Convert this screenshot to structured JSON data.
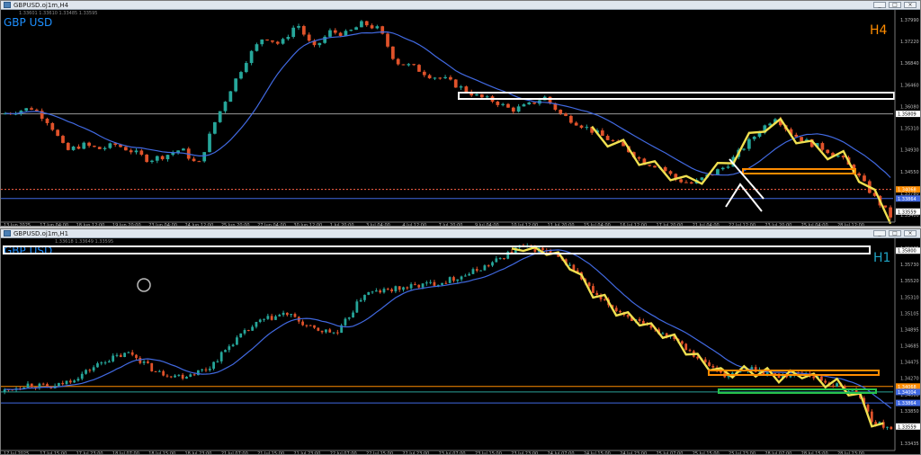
{
  "windows": [
    {
      "window_title": "GBPUSD.oj1m,H4",
      "symbol": "GBP USD",
      "timeframe": "H4",
      "ohlc_info": "1.33601 1.33610 1.33485 1.33595",
      "buttons": [
        "_",
        "□",
        "×"
      ]
    },
    {
      "window_title": "GBPUSD.oj1m,H1",
      "symbol": "GBP USD",
      "timeframe": "H1",
      "ohlc_info": "1.33618 1.33649 1.33595",
      "buttons": [
        "_",
        "□",
        "×"
      ]
    }
  ],
  "colors": {
    "background": "#000000",
    "bull": "#26a69a",
    "bear": "#e0522a",
    "ma": "#4169e1",
    "zigzag": "#f0e050",
    "white_marker": "#ffffff",
    "orange_zone": "#ff8c00",
    "green_zone": "#27c24c",
    "symbol_text": "#1e90ff",
    "tf_h4": "#ff8c00",
    "tf_h1": "#1fa3c4"
  },
  "chart_data": [
    {
      "type": "candlestick",
      "title": "GBPUSD H4",
      "ylim": [
        1.334,
        1.381
      ],
      "y_ticks": [
        "1.37990",
        "1.37220",
        "1.36840",
        "1.36460",
        "1.36080",
        "1.35310",
        "1.34930",
        "1.34550",
        "1.33780",
        "1.33400"
      ],
      "x_ticks": [
        "13 Jun 2025",
        "17 Jun 04:00",
        "18 Jun 12:00",
        "19 Jun 20:00",
        "23 Jun 04:00",
        "24 Jun 12:00",
        "25 Jun 20:00",
        "27 Jun 04:00",
        "30 Jun 12:00",
        "1 Jul 20:00",
        "3 Jul 04:00",
        "4 Jul 12:00",
        "7 Jul 20:00",
        "9 Jul 04:00",
        "10 Jul 12:00",
        "11 Jul 20:00",
        "15 Jul 04:00",
        "16 Jul 12:00",
        "17 Jul 20:00",
        "21 Jul 04:00",
        "22 Jul 12:00",
        "23 Jul 20:00",
        "25 Jul 04:00",
        "28 Jul 12:00"
      ],
      "close_path": [
        [
          0,
          1.358
        ],
        [
          2,
          1.3595
        ],
        [
          3,
          1.356
        ],
        [
          4,
          1.3495
        ],
        [
          5,
          1.351
        ],
        [
          6,
          1.35
        ],
        [
          7,
          1.351
        ],
        [
          8,
          1.3495
        ],
        [
          9,
          1.3475
        ],
        [
          10,
          1.3485
        ],
        [
          11,
          1.35
        ],
        [
          12,
          1.346
        ],
        [
          13,
          1.356
        ],
        [
          14,
          1.364
        ],
        [
          15,
          1.371
        ],
        [
          16,
          1.376
        ],
        [
          17,
          1.374
        ],
        [
          18,
          1.379
        ],
        [
          19,
          1.373
        ],
        [
          20,
          1.377
        ],
        [
          21,
          1.3765
        ],
        [
          22,
          1.379
        ],
        [
          23,
          1.3775
        ],
        [
          24,
          1.37
        ],
        [
          25,
          1.369
        ],
        [
          26,
          1.367
        ],
        [
          27,
          1.366
        ],
        [
          28,
          1.364
        ],
        [
          29,
          1.362
        ],
        [
          30,
          1.361
        ],
        [
          31,
          1.359
        ],
        [
          32,
          1.36
        ],
        [
          33,
          1.362
        ],
        [
          34,
          1.358
        ],
        [
          35,
          1.356
        ],
        [
          36,
          1.354
        ],
        [
          37,
          1.352
        ],
        [
          38,
          1.35
        ],
        [
          39,
          1.347
        ],
        [
          40,
          1.346
        ],
        [
          41,
          1.343
        ],
        [
          42,
          1.342
        ],
        [
          43,
          1.344
        ],
        [
          44,
          1.346
        ],
        [
          45,
          1.35
        ],
        [
          46,
          1.354
        ],
        [
          47,
          1.3575
        ],
        [
          48,
          1.3535
        ],
        [
          49,
          1.3515
        ],
        [
          50,
          1.35
        ],
        [
          51,
          1.348
        ],
        [
          52,
          1.344
        ],
        [
          53,
          1.339
        ],
        [
          54,
          1.3345
        ]
      ],
      "price_labels": [
        "1.35809",
        "1.34068",
        "1.33864",
        "1.33559"
      ],
      "price_levels": [
        1.3581,
        1.3407,
        1.3386,
        1.3356
      ],
      "series": [
        {
          "name": "MA",
          "kind": "line"
        },
        {
          "name": "Zigzag",
          "kind": "line"
        }
      ]
    },
    {
      "type": "candlestick",
      "title": "GBPUSD H1",
      "ylim": [
        1.333,
        1.359
      ],
      "y_ticks": [
        "1.35935",
        "1.35730",
        "1.35520",
        "1.35310",
        "1.35105",
        "1.34895",
        "1.34685",
        "1.34475",
        "1.34270",
        "1.34060",
        "1.33850",
        "1.33645",
        "1.33435"
      ],
      "x_ticks": [
        "17 Jul 2025",
        "17 Jul 15:00",
        "17 Jul 23:00",
        "18 Jul 07:00",
        "18 Jul 15:00",
        "18 Jul 23:00",
        "21 Jul 07:00",
        "21 Jul 15:00",
        "21 Jul 23:00",
        "22 Jul 07:00",
        "22 Jul 15:00",
        "22 Jul 23:00",
        "23 Jul 07:00",
        "23 Jul 15:00",
        "23 Jul 23:00",
        "24 Jul 07:00",
        "24 Jul 15:00",
        "24 Jul 23:00",
        "25 Jul 07:00",
        "25 Jul 15:00",
        "25 Jul 23:00",
        "28 Jul 07:00",
        "28 Jul 15:00",
        "28 Jul 23:00"
      ],
      "close_path": [
        [
          0,
          1.34
        ],
        [
          3,
          1.341
        ],
        [
          6,
          1.3405
        ],
        [
          9,
          1.342
        ],
        [
          12,
          1.344
        ],
        [
          15,
          1.345
        ],
        [
          18,
          1.3425
        ],
        [
          21,
          1.342
        ],
        [
          24,
          1.343
        ],
        [
          27,
          1.3465
        ],
        [
          30,
          1.349
        ],
        [
          33,
          1.35
        ],
        [
          36,
          1.348
        ],
        [
          39,
          1.3475
        ],
        [
          42,
          1.3525
        ],
        [
          45,
          1.353
        ],
        [
          48,
          1.3535
        ],
        [
          51,
          1.354
        ],
        [
          54,
          1.355
        ],
        [
          57,
          1.3565
        ],
        [
          60,
          1.3585
        ],
        [
          63,
          1.358
        ],
        [
          66,
          1.356
        ],
        [
          69,
          1.352
        ],
        [
          72,
          1.35
        ],
        [
          75,
          1.348
        ],
        [
          78,
          1.347
        ],
        [
          81,
          1.344
        ],
        [
          84,
          1.342
        ],
        [
          87,
          1.343
        ],
        [
          90,
          1.342
        ],
        [
          93,
          1.3425
        ],
        [
          96,
          1.341
        ],
        [
          99,
          1.34
        ],
        [
          101,
          1.336
        ],
        [
          103,
          1.3355
        ]
      ],
      "price_labels": [
        "1.35800",
        "1.34068",
        "1.34004",
        "1.33864",
        "1.33559"
      ],
      "price_levels": [
        1.358,
        1.3407,
        1.34,
        1.3386,
        1.3356
      ],
      "series": [
        {
          "name": "MA",
          "kind": "line"
        },
        {
          "name": "Zigzag",
          "kind": "line"
        }
      ]
    }
  ]
}
